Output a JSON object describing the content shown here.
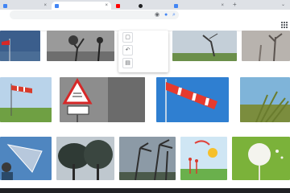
{
  "browser": {
    "tabs": [
      {
        "favicon": "google-icon",
        "active": false
      },
      {
        "favicon": "google-icon",
        "active": true
      },
      {
        "favicon": "youtube-icon",
        "active": false
      },
      {
        "favicon": "dark-icon",
        "active": false
      },
      {
        "favicon": "google-icon",
        "active": false
      }
    ],
    "new_tab_symbol": "+",
    "close_symbol": "×",
    "omnibox_icons": [
      "camera-icon",
      "mic-icon",
      "search-icon"
    ]
  },
  "colors": {
    "tabbar": "#dee1e6",
    "toolbar": "#ffffff",
    "omnibox": "#f1f3f4",
    "accent": "#4285f4"
  },
  "image_results": [
    {
      "subject": "red windsock on pole"
    },
    {
      "subject": "wind-bent trees black and white"
    },
    {
      "subject": "leaning tree on hill"
    },
    {
      "subject": "tree silhouettes in mist"
    },
    {
      "subject": "windsock over green field"
    },
    {
      "subject": "wind warning road sign"
    },
    {
      "subject": "red and white windsock blue sky"
    },
    {
      "subject": "grass blowing by sea"
    },
    {
      "subject": "person with inverted umbrella"
    },
    {
      "subject": "trees bending in storm"
    },
    {
      "subject": "palm trees in wind"
    },
    {
      "subject": "wind turbines illustration"
    },
    {
      "subject": "dandelion seeds blowing"
    }
  ]
}
